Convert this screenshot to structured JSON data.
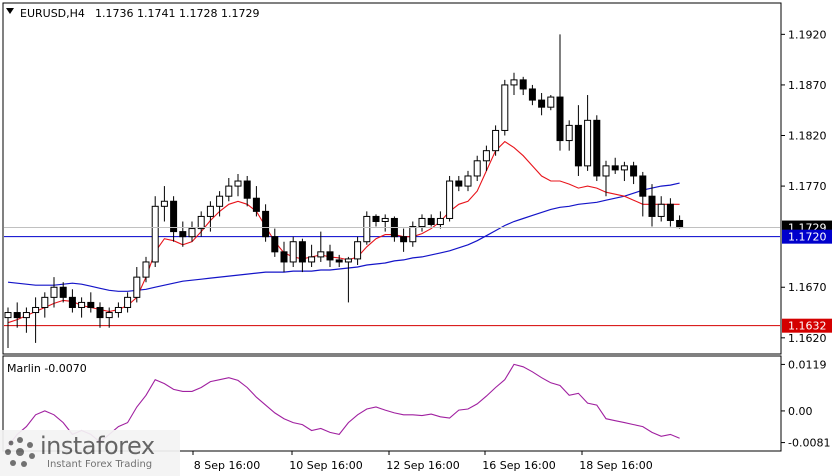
{
  "header": {
    "symbol": "EURUSD,H4",
    "ohlc": "1.1736 1.1741 1.1728 1.1729"
  },
  "indicator": {
    "label": "Marlin -0.0070",
    "levels": [
      "0.0119",
      "0.00",
      "-0.0081"
    ]
  },
  "price_axis": {
    "ticks": [
      "1.1920",
      "1.1870",
      "1.1820",
      "1.1770",
      "1.1670",
      "1.1620"
    ],
    "current_price": "1.1729",
    "blue_level": "1.1720",
    "red_level": "1.1632"
  },
  "time_axis": {
    "ticks": [
      "8 Sep 16:00",
      "10 Sep 16:00",
      "12 Sep 16:00",
      "16 Sep 16:00",
      "18 Sep 16:00"
    ]
  },
  "logo": {
    "name": "instaforex",
    "tagline": "Instant Forex Trading"
  },
  "colors": {
    "bull": "#ffffff",
    "bear": "#000000",
    "ma_fast": "#e8141b",
    "ma_slow": "#1414c8",
    "support_line": "#d40000",
    "blue_line": "#0000cc",
    "oscillator": "#a020a0"
  },
  "chart_data": [
    {
      "type": "candlestick",
      "title": "EURUSD,H4",
      "ylim": [
        1.1605,
        1.195
      ],
      "horizontal_levels": [
        {
          "value": 1.172,
          "color": "blue"
        },
        {
          "value": 1.1632,
          "color": "red"
        }
      ],
      "candles": [
        [
          1.164,
          1.165,
          1.161,
          1.1645
        ],
        [
          1.1645,
          1.1655,
          1.163,
          1.164
        ],
        [
          1.164,
          1.165,
          1.1625,
          1.1645
        ],
        [
          1.1645,
          1.166,
          1.1615,
          1.165
        ],
        [
          1.165,
          1.1665,
          1.164,
          1.166
        ],
        [
          1.166,
          1.168,
          1.165,
          1.167
        ],
        [
          1.167,
          1.1675,
          1.1655,
          1.166
        ],
        [
          1.166,
          1.1668,
          1.1645,
          1.165
        ],
        [
          1.165,
          1.166,
          1.164,
          1.1655
        ],
        [
          1.1655,
          1.1665,
          1.1645,
          1.165
        ],
        [
          1.165,
          1.1655,
          1.163,
          1.164
        ],
        [
          1.164,
          1.165,
          1.163,
          1.1645
        ],
        [
          1.1645,
          1.1655,
          1.164,
          1.165
        ],
        [
          1.165,
          1.1665,
          1.1645,
          1.166
        ],
        [
          1.166,
          1.169,
          1.1655,
          1.168
        ],
        [
          1.168,
          1.17,
          1.1675,
          1.1695
        ],
        [
          1.1695,
          1.176,
          1.169,
          1.175
        ],
        [
          1.175,
          1.177,
          1.1735,
          1.1755
        ],
        [
          1.1755,
          1.176,
          1.1715,
          1.1725
        ],
        [
          1.1725,
          1.1735,
          1.171,
          1.172
        ],
        [
          1.172,
          1.1735,
          1.1715,
          1.1728
        ],
        [
          1.1728,
          1.1745,
          1.172,
          1.174
        ],
        [
          1.174,
          1.1755,
          1.1725,
          1.175
        ],
        [
          1.175,
          1.1765,
          1.174,
          1.176
        ],
        [
          1.176,
          1.1778,
          1.1755,
          1.177
        ],
        [
          1.177,
          1.1782,
          1.176,
          1.1775
        ],
        [
          1.1775,
          1.178,
          1.175,
          1.1758
        ],
        [
          1.1758,
          1.177,
          1.174,
          1.1745
        ],
        [
          1.1745,
          1.1752,
          1.1715,
          1.172
        ],
        [
          1.172,
          1.1728,
          1.17,
          1.1705
        ],
        [
          1.1705,
          1.1715,
          1.1685,
          1.1695
        ],
        [
          1.1695,
          1.172,
          1.169,
          1.1715
        ],
        [
          1.1715,
          1.1718,
          1.1685,
          1.1695
        ],
        [
          1.1695,
          1.1712,
          1.169,
          1.17
        ],
        [
          1.17,
          1.1725,
          1.1695,
          1.1705
        ],
        [
          1.1705,
          1.1712,
          1.169,
          1.1697
        ],
        [
          1.1697,
          1.1702,
          1.169,
          1.1695
        ],
        [
          1.1695,
          1.17,
          1.1655,
          1.1698
        ],
        [
          1.1698,
          1.172,
          1.1692,
          1.1715
        ],
        [
          1.1715,
          1.1745,
          1.1712,
          1.174
        ],
        [
          1.174,
          1.1742,
          1.173,
          1.1735
        ],
        [
          1.1735,
          1.1742,
          1.1725,
          1.1738
        ],
        [
          1.1738,
          1.174,
          1.1715,
          1.172
        ],
        [
          1.172,
          1.1728,
          1.1705,
          1.1715
        ],
        [
          1.1715,
          1.1735,
          1.171,
          1.173
        ],
        [
          1.173,
          1.1742,
          1.1725,
          1.1738
        ],
        [
          1.1738,
          1.1742,
          1.173,
          1.1732
        ],
        [
          1.1732,
          1.1745,
          1.1728,
          1.1738
        ],
        [
          1.1738,
          1.178,
          1.1735,
          1.1775
        ],
        [
          1.1775,
          1.178,
          1.1765,
          1.177
        ],
        [
          1.177,
          1.1785,
          1.1765,
          1.178
        ],
        [
          1.178,
          1.18,
          1.1775,
          1.1795
        ],
        [
          1.1795,
          1.181,
          1.1785,
          1.1805
        ],
        [
          1.1805,
          1.183,
          1.18,
          1.1825
        ],
        [
          1.1825,
          1.1875,
          1.182,
          1.187
        ],
        [
          1.187,
          1.1882,
          1.186,
          1.1875
        ],
        [
          1.1875,
          1.1878,
          1.186,
          1.1866
        ],
        [
          1.1866,
          1.187,
          1.185,
          1.1855
        ],
        [
          1.1855,
          1.1862,
          1.184,
          1.1848
        ],
        [
          1.1848,
          1.186,
          1.1845,
          1.1858
        ],
        [
          1.1858,
          1.192,
          1.1805,
          1.1815
        ],
        [
          1.1815,
          1.1835,
          1.1805,
          1.183
        ],
        [
          1.183,
          1.185,
          1.178,
          1.179
        ],
        [
          1.179,
          1.186,
          1.1785,
          1.1835
        ],
        [
          1.1835,
          1.184,
          1.1775,
          1.178
        ],
        [
          1.178,
          1.1795,
          1.176,
          1.179
        ],
        [
          1.179,
          1.1798,
          1.1782,
          1.1786
        ],
        [
          1.1786,
          1.1794,
          1.1775,
          1.179
        ],
        [
          1.179,
          1.1794,
          1.1772,
          1.178
        ],
        [
          1.178,
          1.1784,
          1.174,
          1.176
        ],
        [
          1.176,
          1.1772,
          1.173,
          1.174
        ],
        [
          1.174,
          1.176,
          1.1735,
          1.1752
        ],
        [
          1.1752,
          1.1758,
          1.173,
          1.1736
        ],
        [
          1.1736,
          1.1741,
          1.1728,
          1.1729
        ]
      ],
      "ma_fast": [
        1.1635,
        1.1638,
        1.1642,
        1.1646,
        1.165,
        1.1654,
        1.1657,
        1.1656,
        1.1652,
        1.165,
        1.1648,
        1.1646,
        1.1648,
        1.1652,
        1.166,
        1.168,
        1.1705,
        1.1718,
        1.1716,
        1.1712,
        1.1715,
        1.1725,
        1.1736,
        1.1745,
        1.1752,
        1.1755,
        1.1752,
        1.1745,
        1.173,
        1.1715,
        1.1704,
        1.17,
        1.1698,
        1.17,
        1.1702,
        1.17,
        1.1699,
        1.1697,
        1.17,
        1.171,
        1.1718,
        1.1722,
        1.1722,
        1.172,
        1.172,
        1.1723,
        1.1728,
        1.1735,
        1.1745,
        1.1752,
        1.1755,
        1.1765,
        1.1785,
        1.1805,
        1.1814,
        1.1808,
        1.18,
        1.179,
        1.178,
        1.1775,
        1.1775,
        1.1772,
        1.1768,
        1.177,
        1.1768,
        1.1764,
        1.1762,
        1.176,
        1.1756,
        1.1752,
        1.1752,
        1.1752,
        1.1752,
        1.1752
      ],
      "ma_slow": [
        1.1675,
        1.1674,
        1.1673,
        1.1672,
        1.1672,
        1.1672,
        1.1673,
        1.1674,
        1.1673,
        1.1671,
        1.1669,
        1.1667,
        1.1666,
        1.1666,
        1.1667,
        1.1668,
        1.167,
        1.1672,
        1.1674,
        1.1676,
        1.1677,
        1.1678,
        1.1679,
        1.168,
        1.1681,
        1.1682,
        1.1683,
        1.1684,
        1.1685,
        1.1685,
        1.1685,
        1.1686,
        1.1686,
        1.1686,
        1.1687,
        1.1687,
        1.1688,
        1.1689,
        1.169,
        1.1692,
        1.1693,
        1.1694,
        1.1696,
        1.1697,
        1.1699,
        1.17,
        1.1702,
        1.1704,
        1.1706,
        1.1709,
        1.1712,
        1.1716,
        1.1721,
        1.1726,
        1.1731,
        1.1735,
        1.1738,
        1.1741,
        1.1744,
        1.1747,
        1.1749,
        1.175,
        1.1752,
        1.1753,
        1.1754,
        1.1756,
        1.1758,
        1.176,
        1.1763,
        1.1766,
        1.1768,
        1.177,
        1.1771,
        1.1773
      ]
    },
    {
      "type": "line",
      "title": "Marlin -0.0070",
      "ylim": [
        -0.01,
        0.0138
      ],
      "series": [
        {
          "name": "Marlin",
          "values": [
            -0.009,
            -0.006,
            -0.004,
            -0.001,
            0.0,
            -0.001,
            -0.003,
            -0.006,
            -0.005,
            -0.006,
            -0.008,
            -0.006,
            -0.004,
            -0.003,
            0.001,
            0.004,
            0.008,
            0.007,
            0.0055,
            0.005,
            0.005,
            0.006,
            0.0075,
            0.008,
            0.0085,
            0.0078,
            0.006,
            0.0035,
            0.0015,
            -0.0005,
            -0.002,
            -0.003,
            -0.0035,
            -0.005,
            -0.0045,
            -0.0055,
            -0.006,
            -0.003,
            -0.001,
            0.0005,
            0.001,
            0.0002,
            -0.0005,
            -0.001,
            -0.001,
            -0.0012,
            -0.0008,
            -0.0015,
            -0.0018,
            0.0002,
            0.0005,
            0.0018,
            0.0038,
            0.006,
            0.008,
            0.0119,
            0.0113,
            0.01,
            0.0085,
            0.0072,
            0.0065,
            0.004,
            0.0045,
            0.002,
            0.0015,
            -0.002,
            -0.0025,
            -0.003,
            -0.0035,
            -0.004,
            -0.0055,
            -0.0065,
            -0.006,
            -0.007
          ]
        }
      ]
    }
  ]
}
